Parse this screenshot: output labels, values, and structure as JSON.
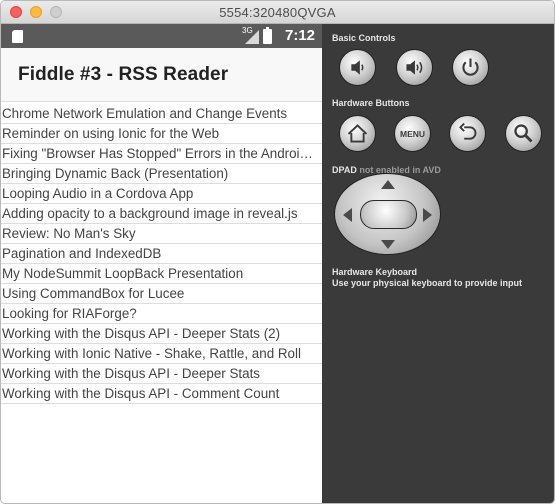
{
  "window": {
    "title": "5554:320480QVGA"
  },
  "statusbar": {
    "network": "3G",
    "time": "7:12"
  },
  "app": {
    "title": "Fiddle #3 - RSS Reader",
    "items": [
      "Chrome Network Emulation and Change Events",
      "Reminder on using Ionic for the Web",
      "Fixing \"Browser Has Stopped\" Errors in the Android Emulator",
      "Bringing Dynamic Back (Presentation)",
      "Looping Audio in a Cordova App",
      "Adding opacity to a background image in reveal.js",
      "Review: No Man's Sky",
      "Pagination and IndexedDB",
      "My NodeSummit LoopBack Presentation",
      "Using CommandBox for Lucee",
      "Looking for RIAForge?",
      "Working with the Disqus API - Deeper Stats (2)",
      "Working with Ionic Native - Shake, Rattle, and Roll",
      "Working with the Disqus API - Deeper Stats",
      "Working with the Disqus API - Comment Count"
    ]
  },
  "controls": {
    "basic_label": "Basic Controls",
    "basic_buttons": [
      "volume-down-icon",
      "volume-up-icon",
      "power-icon"
    ],
    "hardware_label": "Hardware Buttons",
    "menu_label": "MENU",
    "dpad_label": "DPAD",
    "dpad_note": "not enabled in AVD",
    "keyboard_title": "Hardware Keyboard",
    "keyboard_note": "Use your physical keyboard to provide input"
  }
}
